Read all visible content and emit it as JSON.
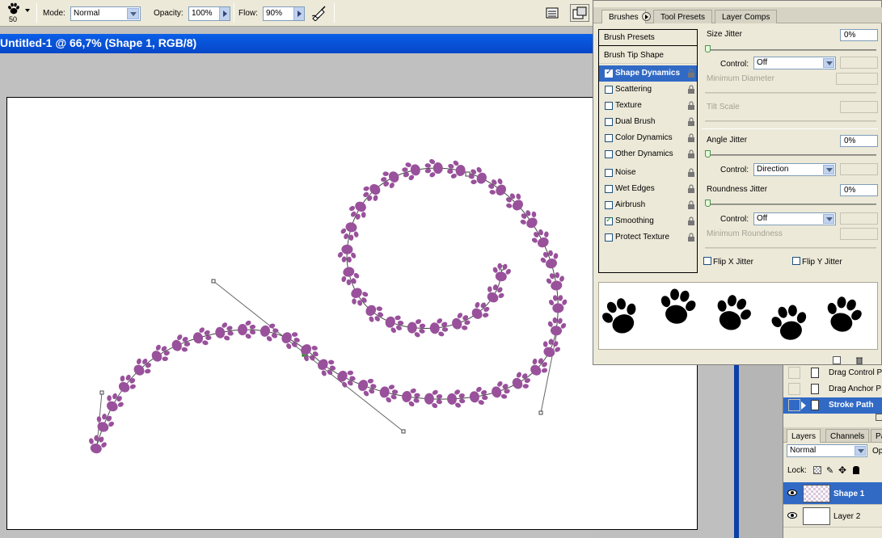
{
  "options_bar": {
    "brush_size": "50",
    "mode_label": "Mode:",
    "mode_value": "Normal",
    "opacity_label": "Opacity:",
    "opacity_value": "100%",
    "flow_label": "Flow:",
    "flow_value": "90%"
  },
  "document": {
    "title": "Untitled-1 @ 66,7% (Shape 1, RGB/8)"
  },
  "brushes_palette": {
    "tabs": [
      "Brushes",
      "Tool Presets",
      "Layer Comps"
    ],
    "brush_presets": "Brush Presets",
    "brush_tip_shape": "Brush Tip Shape",
    "items": [
      {
        "label": "Shape Dynamics",
        "checked": true,
        "selected": true
      },
      {
        "label": "Scattering",
        "checked": false
      },
      {
        "label": "Texture",
        "checked": false
      },
      {
        "label": "Dual Brush",
        "checked": false
      },
      {
        "label": "Color Dynamics",
        "checked": false
      },
      {
        "label": "Other Dynamics",
        "checked": false
      },
      {
        "label": "Noise",
        "checked": false
      },
      {
        "label": "Wet Edges",
        "checked": false
      },
      {
        "label": "Airbrush",
        "checked": false
      },
      {
        "label": "Smoothing",
        "checked": true
      },
      {
        "label": "Protect Texture",
        "checked": false
      }
    ],
    "size_jitter_label": "Size Jitter",
    "size_jitter_value": "0%",
    "control_label": "Control:",
    "size_control_value": "Off",
    "minimum_diameter_label": "Minimum Diameter",
    "tilt_scale_label": "Tilt Scale",
    "angle_jitter_label": "Angle Jitter",
    "angle_jitter_value": "0%",
    "angle_control_value": "Direction",
    "roundness_jitter_label": "Roundness Jitter",
    "roundness_jitter_value": "0%",
    "roundness_control_value": "Off",
    "minimum_roundness_label": "Minimum Roundness",
    "flip_x_label": "Flip X Jitter",
    "flip_y_label": "Flip Y Jitter"
  },
  "history": {
    "items": [
      {
        "label": "Drag Control P",
        "selected": false
      },
      {
        "label": "Drag Anchor P",
        "selected": false
      },
      {
        "label": "Stroke Path",
        "selected": true
      }
    ]
  },
  "layers_panel": {
    "tabs": [
      "Layers",
      "Channels",
      "Pa"
    ],
    "blend_mode": "Normal",
    "opacity_abbrev": "Op",
    "lock_label": "Lock:",
    "layers": [
      {
        "name": "Shape 1",
        "selected": true
      },
      {
        "name": "Layer 2",
        "selected": false
      }
    ]
  },
  "colors": {
    "paw": "#99519b",
    "titlebar": "#0a5fe8",
    "selection": "#316ac5"
  }
}
